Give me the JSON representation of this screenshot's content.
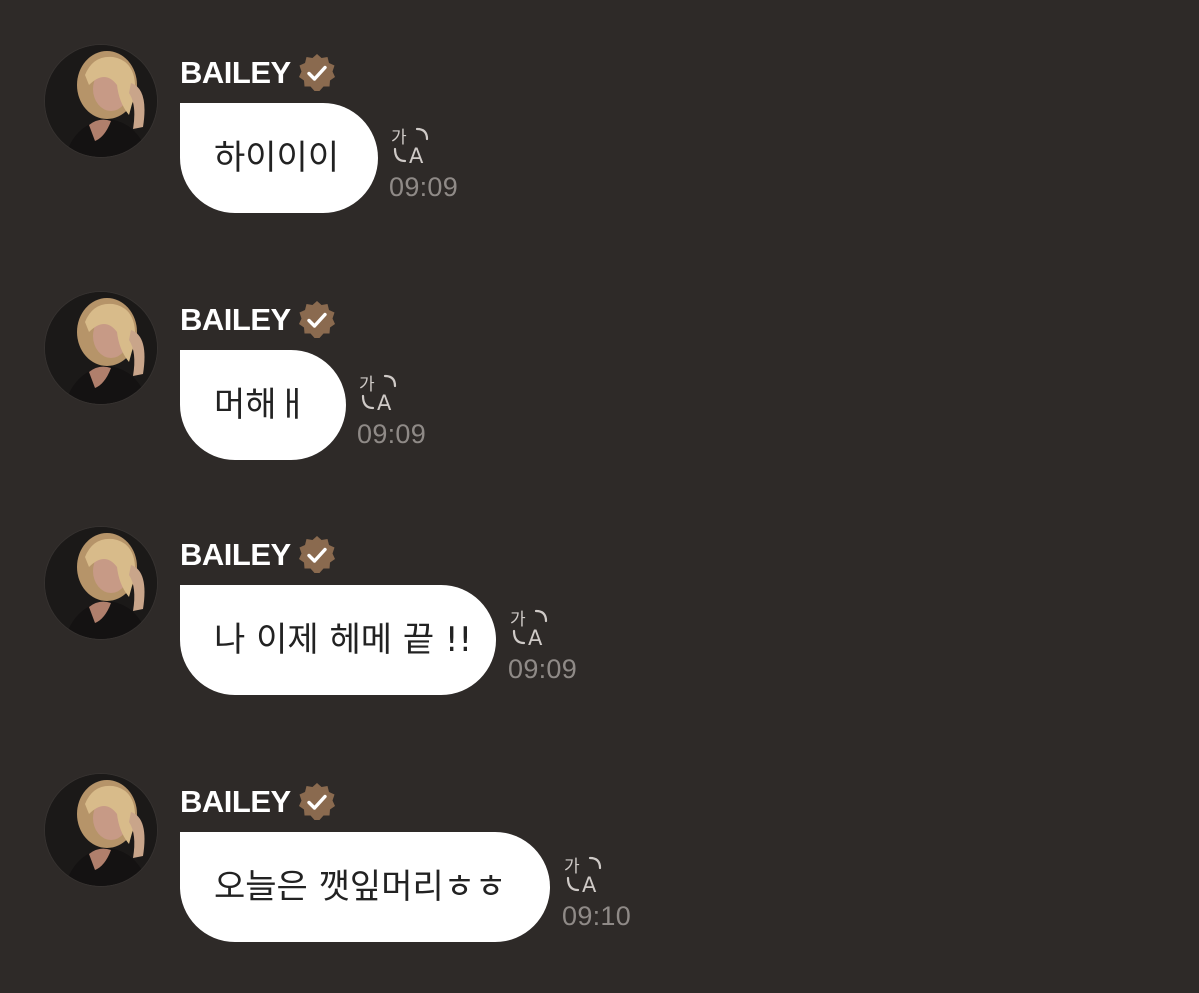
{
  "messages": [
    {
      "sender": "BAILEY",
      "text": "하이이이",
      "time": "09:09"
    },
    {
      "sender": "BAILEY",
      "text": "머해ㅐ",
      "time": "09:09"
    },
    {
      "sender": "BAILEY",
      "text": "나 이제 헤메 끝 !!",
      "time": "09:09"
    },
    {
      "sender": "BAILEY",
      "text": "오늘은 깻잎머리ㅎㅎ",
      "time": "09:10"
    }
  ],
  "icons": {
    "verified_badge": "verified-badge-icon",
    "translate": "translate-icon"
  },
  "colors": {
    "background": "#2e2a28",
    "bubble": "#ffffff",
    "bubble_text": "#222222",
    "name": "#ffffff",
    "badge": "#8a6a4f",
    "timestamp": "#8f8a87"
  }
}
